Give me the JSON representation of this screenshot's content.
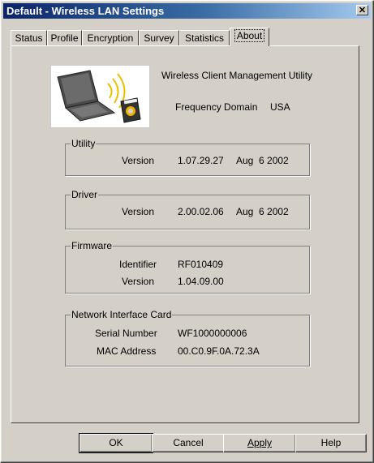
{
  "window": {
    "title": "Default - Wireless LAN Settings"
  },
  "tabs": [
    {
      "label": "Status"
    },
    {
      "label": "Profile"
    },
    {
      "label": "Encryption"
    },
    {
      "label": "Survey"
    },
    {
      "label": "Statistics"
    },
    {
      "label": "About",
      "selected": true
    }
  ],
  "about": {
    "app_name": "Wireless Client Management Utility",
    "freq_label": "Frequency Domain",
    "freq_value": "USA",
    "utility": {
      "legend": "Utility",
      "version_label": "Version",
      "version": "1.07.29.27",
      "date": "Aug  6 2002"
    },
    "driver": {
      "legend": "Driver",
      "version_label": "Version",
      "version": "2.00.02.06",
      "date": "Aug  6 2002"
    },
    "firmware": {
      "legend": "Firmware",
      "identifier_label": "Identifier",
      "identifier": "RF010409",
      "version_label": "Version",
      "version": "1.04.09.00"
    },
    "nic": {
      "legend": "Network Interface Card",
      "serial_label": "Serial Number",
      "serial": "WF1000000006",
      "mac_label": "MAC Address",
      "mac": "00.C0.9F.0A.72.3A"
    }
  },
  "buttons": {
    "ok": "OK",
    "cancel": "Cancel",
    "apply": "Apply",
    "help": "Help"
  },
  "icons": {
    "close": "close-icon",
    "logo": "laptop-wireless-logo"
  }
}
